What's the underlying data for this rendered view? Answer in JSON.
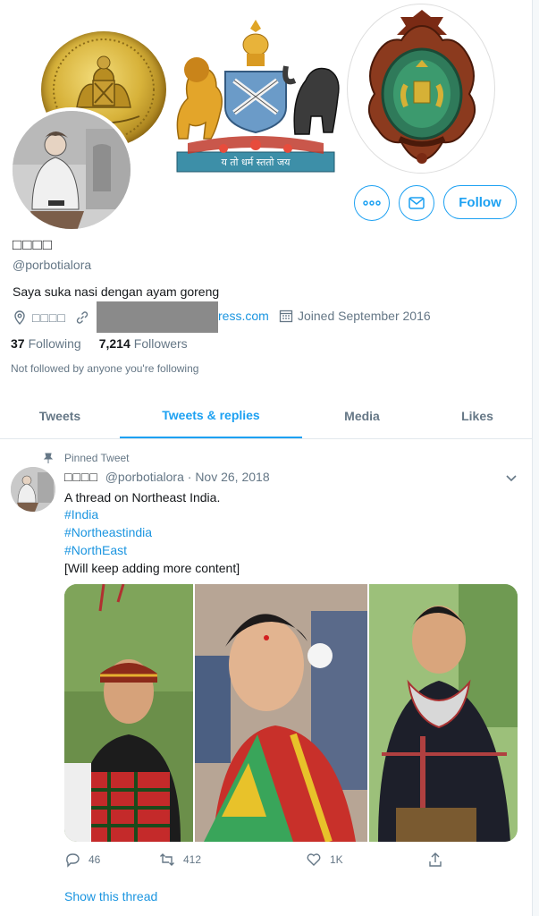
{
  "profile": {
    "display_name": "□□□□",
    "handle": "@porbotialora",
    "bio": "Saya suka nasi dengan ayam goreng",
    "location": "□□□□",
    "website_suffix": "ress.com",
    "joined": "Joined September 2016",
    "following_count": "37",
    "following_label": "Following",
    "followers_count": "7,214",
    "followers_label": "Followers",
    "not_followed": "Not followed by anyone you're following"
  },
  "actions": {
    "follow_label": "Follow"
  },
  "banner": {
    "crest_motto": "य तो धर्म स्ततो जय"
  },
  "tabs": [
    {
      "label": "Tweets"
    },
    {
      "label": "Tweets & replies"
    },
    {
      "label": "Media"
    },
    {
      "label": "Likes"
    }
  ],
  "tweet": {
    "pinned_label": "Pinned Tweet",
    "author_name": "□□□□",
    "author_handle": "@porbotialora",
    "date": "· Nov 26, 2018",
    "lines": [
      "A thread on Northeast India.",
      "#India",
      "#Northeastindia",
      "#NorthEast",
      "[Will keep adding more content]"
    ],
    "reply_count": "46",
    "retweet_count": "412",
    "like_count": "1K",
    "show_thread": "Show this thread"
  },
  "colors": {
    "accent": "#1da1f2",
    "link": "#1b95e0",
    "muted": "#657786"
  }
}
